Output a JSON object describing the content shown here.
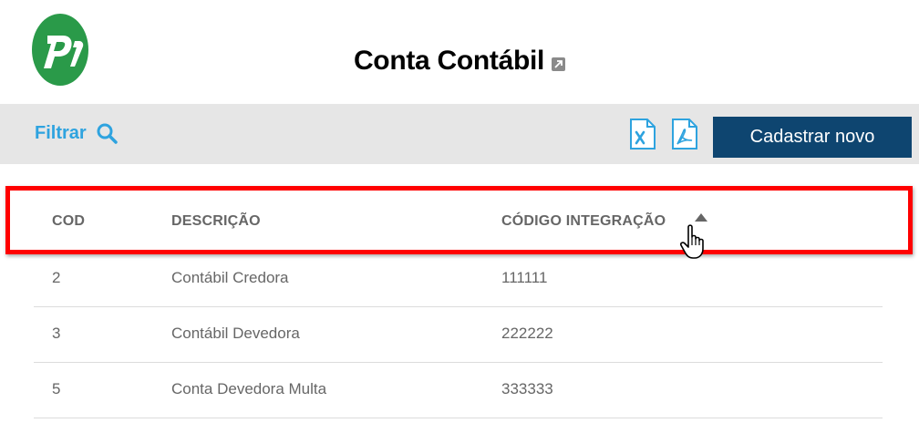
{
  "header": {
    "logo_text": "P",
    "title": "Conta Contábil"
  },
  "toolbar": {
    "filter_label": "Filtrar",
    "new_button_label": "Cadastrar novo"
  },
  "table": {
    "columns": [
      "COD",
      "DESCRIÇÃO",
      "CÓDIGO INTEGRAÇÃO"
    ],
    "sorted_column": "CÓDIGO INTEGRAÇÃO",
    "sort_direction": "asc",
    "rows": [
      {
        "cod": "2",
        "descricao": "Contábil Credora",
        "codigo_integracao": "111111"
      },
      {
        "cod": "3",
        "descricao": "Contábil Devedora",
        "codigo_integracao": "222222"
      },
      {
        "cod": "5",
        "descricao": "Conta Devedora Multa",
        "codigo_integracao": "333333"
      }
    ]
  },
  "colors": {
    "brand_green": "#2a9a49",
    "filter_blue": "#2ea3df",
    "button_navy": "#0e4570",
    "toolbar_bg": "#e6e6e6",
    "highlight_red": "#ff0000"
  },
  "icons": [
    "logo-icon",
    "external-link-icon",
    "search-icon",
    "excel-export-icon",
    "pdf-export-icon",
    "sort-ascending-icon",
    "hand-pointer-cursor-icon"
  ]
}
